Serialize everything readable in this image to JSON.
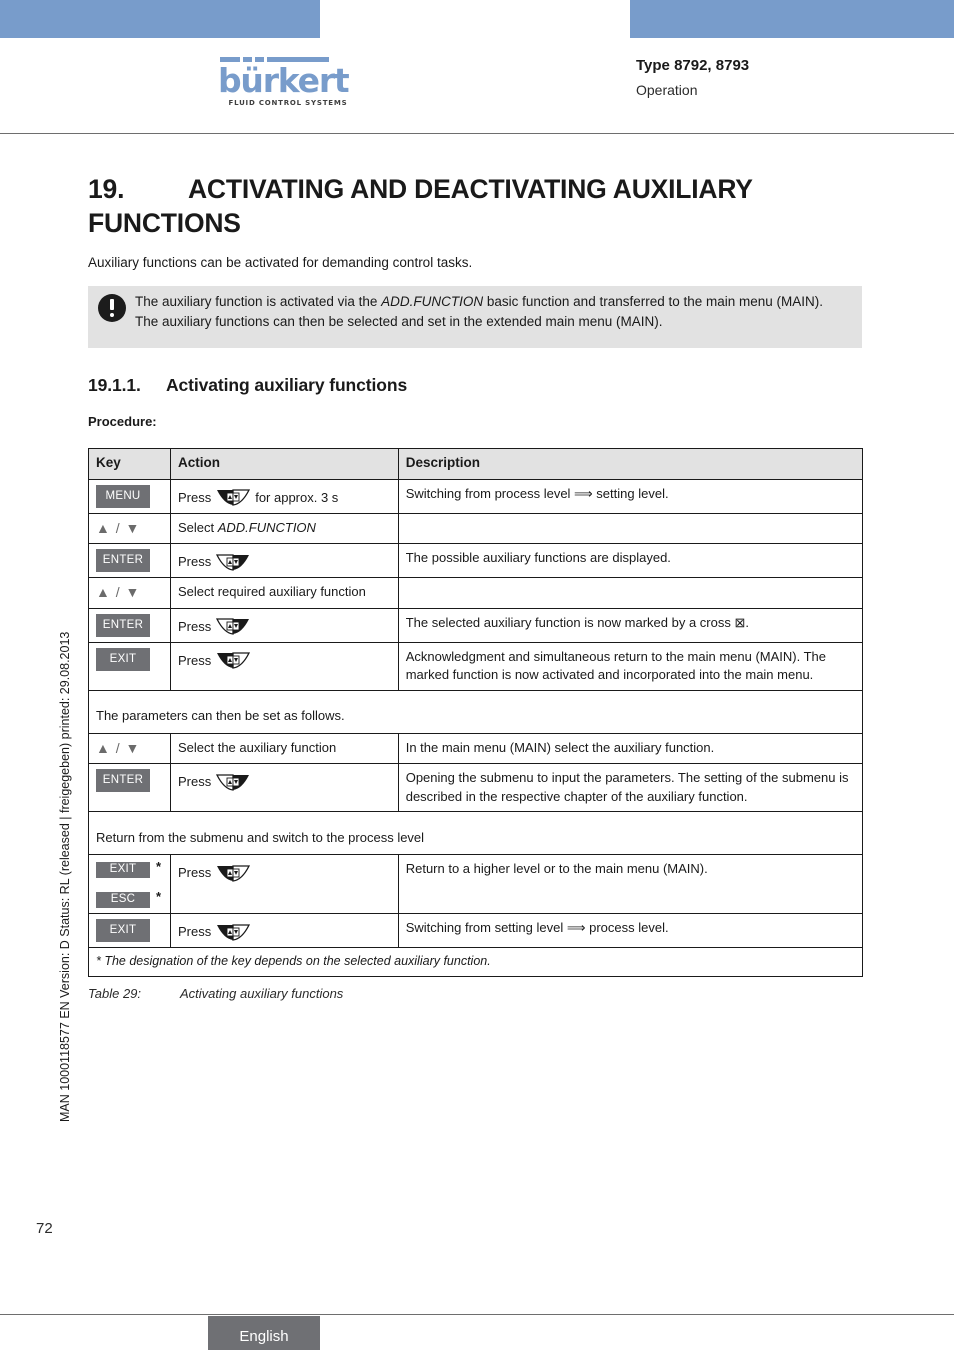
{
  "header": {
    "logo_word": "bürkert",
    "logo_tagline": "FLUID CONTROL SYSTEMS",
    "type_line": "Type 8792, 8793",
    "sub_line": "Operation"
  },
  "side_note": "MAN 1000118577  EN  Version: D  Status: RL (released | freigegeben)  printed: 29.08.2013",
  "chapter": {
    "number": "19.",
    "title": "ACTIVATING AND DEACTIVATING AUXILIARY FUNCTIONS",
    "intro": "Auxiliary functions can be activated for demanding control tasks."
  },
  "note": {
    "icon": "exclamation-circle-icon",
    "line1_a": "The auxiliary function is activated via the ",
    "line1_em": "ADD.FUNCTION",
    "line1_b": " basic function and transferred to the main menu (MAIN).",
    "line2": "The auxiliary functions can then be selected and set in the extended main menu (MAIN)."
  },
  "section": {
    "number": "19.1.1.",
    "title": "Activating auxiliary functions",
    "procedure_label": "Procedure:"
  },
  "table": {
    "columns": [
      "Key",
      "Action",
      "Description"
    ],
    "rows": [
      {
        "key_type": "badge",
        "key": "MENU",
        "star": "",
        "action_prefix": "Press",
        "action_icon": "menu-key-icon",
        "action_suffix": "for approx. 3 s",
        "desc": "Switching from process level ⟹ setting level."
      },
      {
        "key_type": "arrows",
        "key": "▲ / ▼",
        "star": "",
        "action_text": "Select ADD.FUNCTION",
        "action_italic": "ADD.FUNCTION",
        "action_plain": "Select ",
        "desc": ""
      },
      {
        "key_type": "badge",
        "key": "ENTER",
        "star": "",
        "action_prefix": "Press",
        "action_icon": "enter-key-icon",
        "action_suffix": "",
        "desc": "The possible auxiliary functions are displayed."
      },
      {
        "key_type": "arrows",
        "key": "▲ / ▼",
        "star": "",
        "action_plain": "Select required auxiliary function",
        "action_italic": "",
        "desc": ""
      },
      {
        "key_type": "badge",
        "key": "ENTER",
        "star": "",
        "action_prefix": "Press",
        "action_icon": "enter-key-icon",
        "action_suffix": "",
        "desc": "The selected auxiliary function is now marked by a cross ⊠."
      },
      {
        "key_type": "badge",
        "key": "EXIT",
        "star": "",
        "action_prefix": "Press",
        "action_icon": "exit-key-icon",
        "action_suffix": "",
        "desc": "Acknowledgment and simultaneous return to the main menu (MAIN). The marked function is now activated and incorporated into the main menu."
      }
    ],
    "note_row_1": "The parameters can then be set as follows.",
    "rows2": [
      {
        "key_type": "arrows",
        "key": "▲ / ▼",
        "star": "",
        "action_plain": "Select the auxiliary function",
        "action_italic": "",
        "desc": "In the main menu (MAIN) select the auxiliary function."
      },
      {
        "key_type": "badge",
        "key": "ENTER",
        "star": "",
        "action_prefix": "Press",
        "action_icon": "enter-key-icon",
        "action_suffix": "",
        "desc": "Opening the submenu to input the parameters. The setting of the submenu is described in the respective chapter of the auxiliary function."
      }
    ],
    "note_row_2": "Return from the submenu and switch to the process level",
    "rows3": [
      {
        "key_type": "badge-pair",
        "key": "EXIT",
        "key2": "ESC",
        "star": "*",
        "star2": "*",
        "action_prefix": "Press",
        "action_icon": "exit-key-icon",
        "action_suffix": "",
        "desc": "Return to a higher level or to the main menu (MAIN)."
      },
      {
        "key_type": "badge",
        "key": "EXIT",
        "star": "",
        "action_prefix": "Press",
        "action_icon": "exit-key-icon",
        "action_suffix": "",
        "desc": "Switching from setting level ⟹ process level."
      }
    ],
    "footnote": "* The designation of the key depends on the selected auxiliary function."
  },
  "caption": {
    "label": "Table 29:",
    "text": "Activating auxiliary functions"
  },
  "footer": {
    "page_number": "72",
    "language": "English"
  },
  "colors": {
    "brand_blue": "#789ccb",
    "badge_gray": "#6f7074",
    "note_bg": "#e2e2e2"
  }
}
